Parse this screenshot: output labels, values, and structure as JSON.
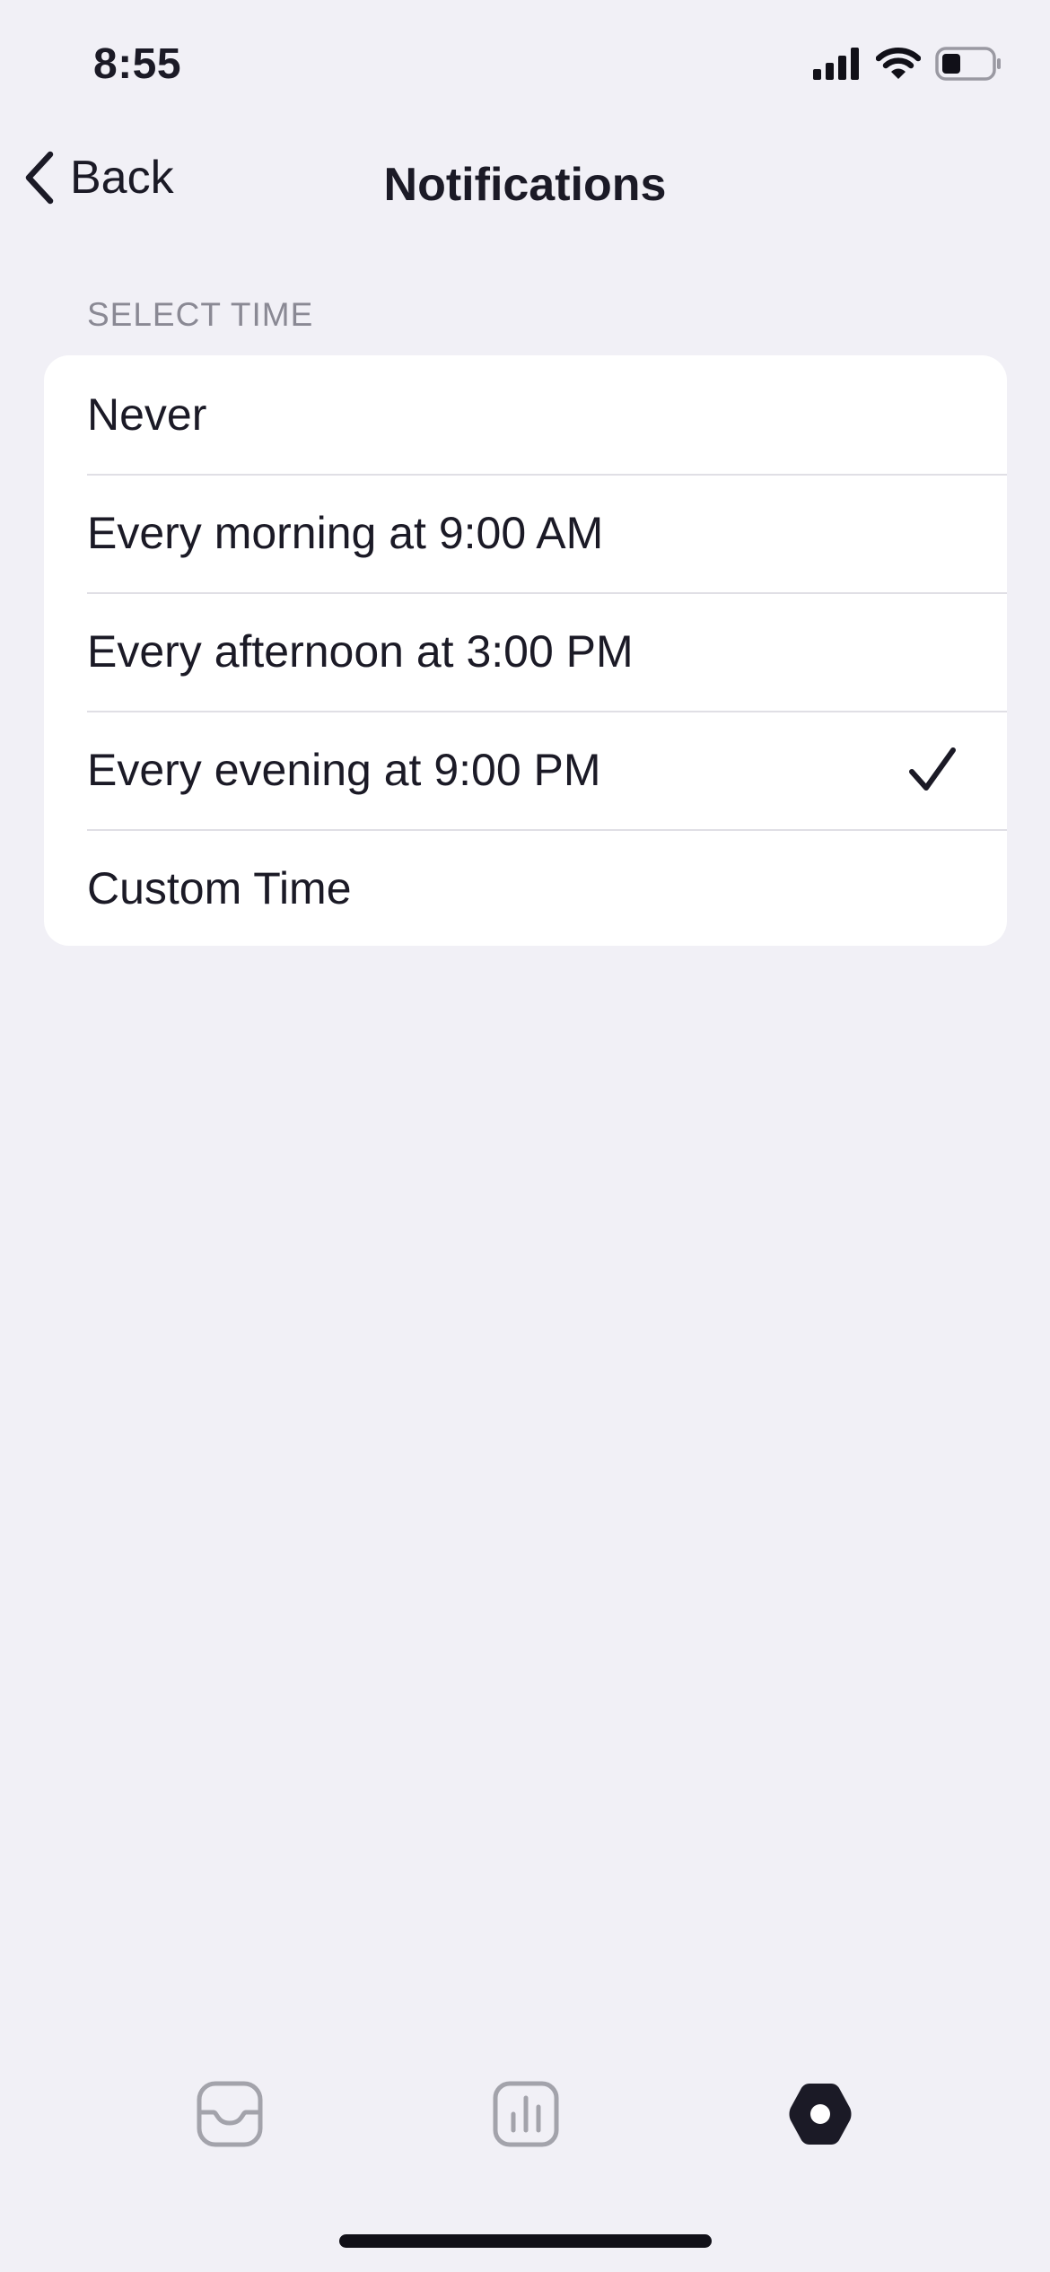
{
  "status_bar": {
    "time": "8:55"
  },
  "nav": {
    "back_label": "Back",
    "title": "Notifications"
  },
  "section": {
    "header": "SELECT TIME"
  },
  "options": [
    {
      "label": "Never",
      "selected": false
    },
    {
      "label": "Every morning at 9:00 AM",
      "selected": false
    },
    {
      "label": "Every afternoon at 3:00 PM",
      "selected": false
    },
    {
      "label": "Every evening at 9:00 PM",
      "selected": true
    },
    {
      "label": "Custom Time",
      "selected": false
    }
  ],
  "tab_bar": {
    "tabs": [
      {
        "icon": "inbox-icon",
        "active": false
      },
      {
        "icon": "bar-chart-icon",
        "active": false
      },
      {
        "icon": "settings-hexagon-icon",
        "active": true
      }
    ],
    "active_color": "#1b1a26",
    "inactive_color": "#a3a3ab"
  },
  "colors": {
    "background": "#f1f0f6",
    "text": "#1b1a26",
    "secondary_text": "#8a8994"
  }
}
